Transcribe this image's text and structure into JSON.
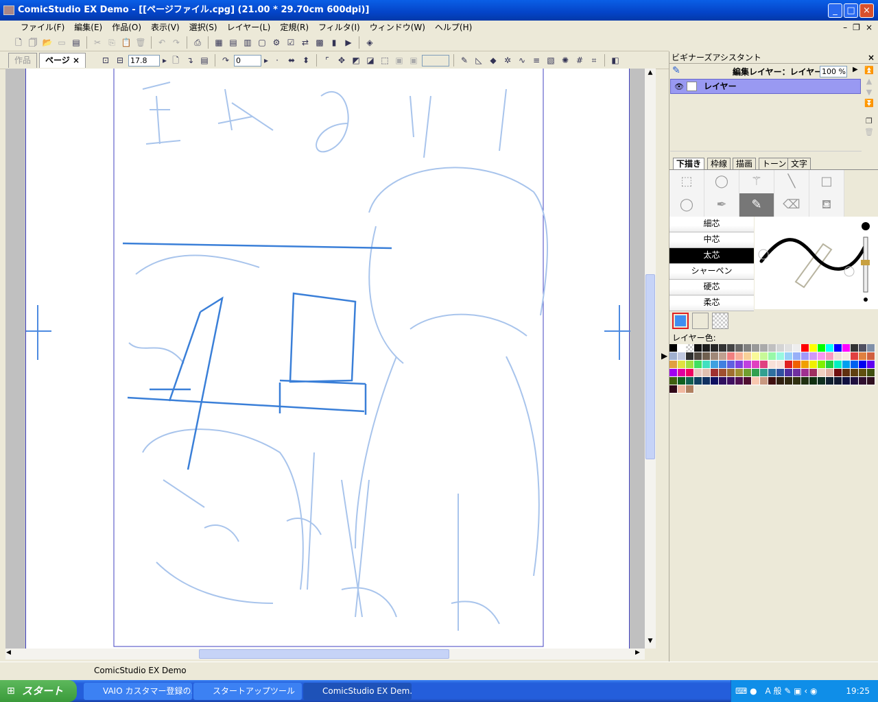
{
  "window": {
    "title": "ComicStudio EX Demo - [[ページファイル.cpg] (21.00 * 29.70cm 600dpi)]"
  },
  "menu": [
    "ファイル(F)",
    "編集(E)",
    "作品(O)",
    "表示(V)",
    "選択(S)",
    "レイヤー(L)",
    "定規(R)",
    "フィルタ(I)",
    "ウィンドウ(W)",
    "ヘルプ(H)"
  ],
  "doc_tabs": {
    "work": "作品",
    "page": "ページ",
    "close": "×"
  },
  "toolbar2": {
    "zoom_value": "17.8",
    "rotate_value": "0"
  },
  "panel": {
    "title": "ビギナーズアシスタント",
    "close": "×",
    "edit_layer_label": "編集レイヤー：レイヤー",
    "opacity": "100 %",
    "layer_name": "レイヤー",
    "tabs": [
      "下描き",
      "枠線",
      "描画",
      "トーン",
      "文字"
    ],
    "brushes": [
      "細芯",
      "中芯",
      "太芯",
      "シャーペン",
      "硬芯",
      "柔芯"
    ],
    "selected_brush": "太芯",
    "layer_color_label": "レイヤー色:",
    "current_color": "#3f8ef0",
    "palette": [
      "#000000",
      "#ffffff",
      "transparent",
      "#111111",
      "#1c1c1c",
      "#262626",
      "#333333",
      "#444444",
      "#666666",
      "#808080",
      "#999999",
      "#aaaaaa",
      "#c0c0c0",
      "#d4d4d4",
      "#e0e0e0",
      "#eeeeee",
      "#ff0000",
      "#ffff00",
      "#00ff00",
      "#00ffff",
      "#0000ff",
      "#ff00ff",
      "#333333",
      "#505060",
      "#8090a8",
      "#a0b0d0",
      "#c0c8e0",
      "#303030",
      "#504840",
      "#706050",
      "#a08878",
      "#c0a090",
      "#f08080",
      "#f8b098",
      "#f8d098",
      "#f8f898",
      "#c8f898",
      "#98f8a8",
      "#98f8e0",
      "#98d0f8",
      "#98b0f8",
      "#a098f8",
      "#d098f8",
      "#f898f0",
      "#f898c0",
      "#f0e0d8",
      "#f8e8e0",
      "#e04040",
      "#e08040",
      "#d06040",
      "#e0a040",
      "#e0e040",
      "#a0e040",
      "#40e060",
      "#40e0c0",
      "#40a0e0",
      "#4080e0",
      "#6060e0",
      "#8040e0",
      "#c040e0",
      "#e040c0",
      "#e04080",
      "#f8e0d8",
      "#f8e0d8",
      "#e02020",
      "#f06000",
      "#f0a000",
      "#f0f000",
      "#80f000",
      "#20d040",
      "#00f0c0",
      "#00a0f0",
      "#0060f0",
      "#0000f0",
      "#6000f0",
      "#a000f0",
      "#e000a0",
      "#f00060",
      "#e8c8c0",
      "#e0c0b0",
      "#a03030",
      "#a05030",
      "#a07030",
      "#a09030",
      "#70a030",
      "#30a050",
      "#30a090",
      "#3070a0",
      "#3050a0",
      "#5030a0",
      "#7030a0",
      "#a03090",
      "#a03060",
      "#f0d0c0",
      "#e0b0a0",
      "#701010",
      "#603010",
      "#604010",
      "#605010",
      "#405010",
      "#406010",
      "#106020",
      "#106050",
      "#104060",
      "#103060",
      "#101060",
      "#301060",
      "#401060",
      "#501050",
      "#501030",
      "#f8c8b0",
      "#c89880",
      "#401010",
      "#302010",
      "#302810",
      "#303010",
      "#203010",
      "#103010",
      "#103020",
      "#102030",
      "#101830",
      "#101040",
      "#201040",
      "#301030",
      "#301020",
      "#300818",
      "#f0b8a0",
      "#b08060"
    ]
  },
  "status": {
    "text": "ComicStudio EX Demo"
  },
  "taskbar": {
    "start": "スタート",
    "tasks": [
      "VAIO カスタマー登録の...",
      "スタートアップツール",
      "ComicStudio EX Dem..."
    ],
    "tray_ime": "A 般",
    "clock": "19:25"
  }
}
